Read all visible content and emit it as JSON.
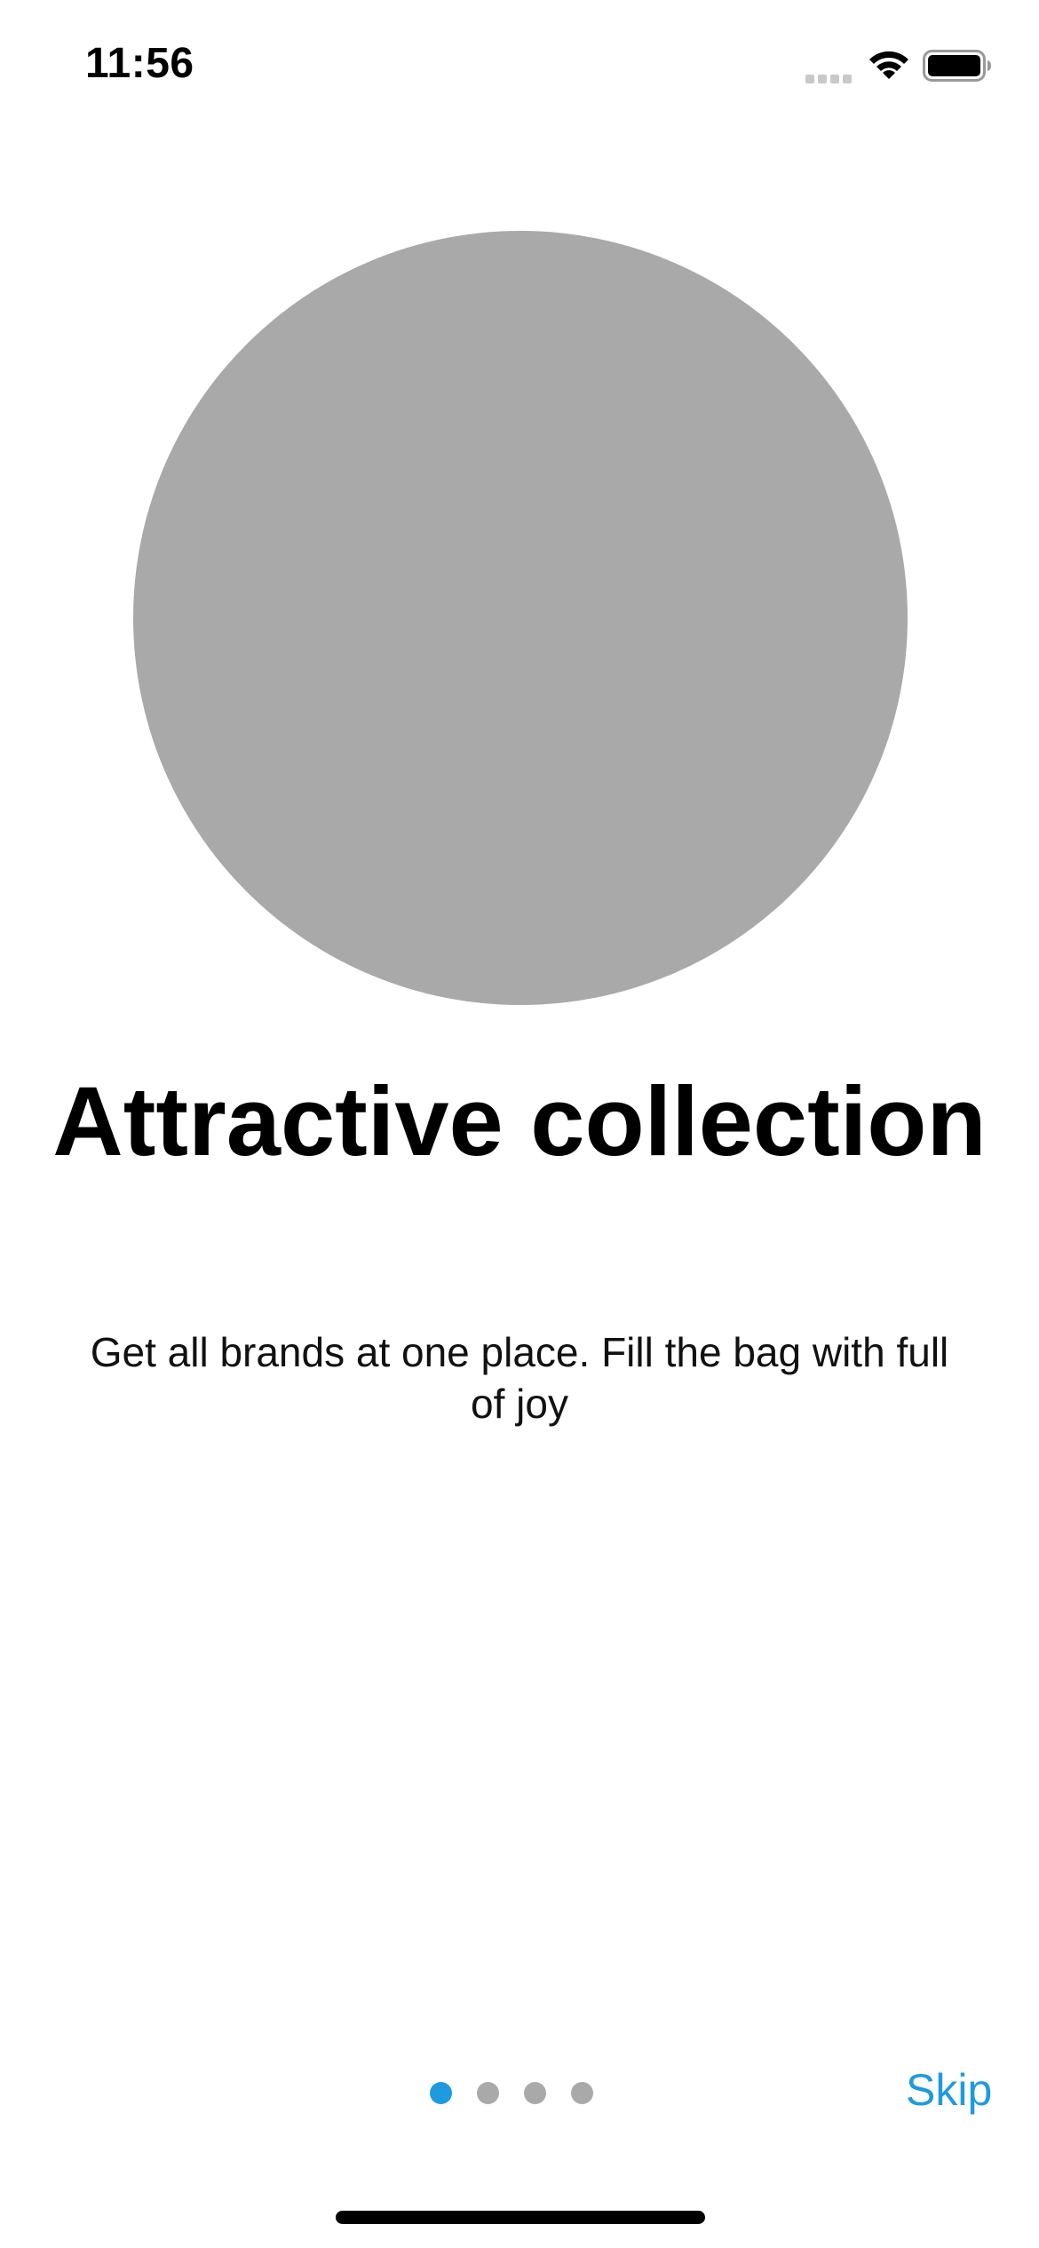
{
  "status_bar": {
    "time": "11:56",
    "icons": [
      "cellular-signal-icon",
      "wifi-icon",
      "battery-icon"
    ]
  },
  "onboarding": {
    "title": "Attractive collection",
    "subtitle": "Get all brands at one place. Fill the bag with full of joy",
    "image_placeholder_color": "#A9A9A9"
  },
  "pager": {
    "total_pages": 4,
    "current_page": 1,
    "active_color": "#1E9AE0",
    "inactive_color": "#A9A9A9"
  },
  "actions": {
    "skip_label": "Skip"
  }
}
